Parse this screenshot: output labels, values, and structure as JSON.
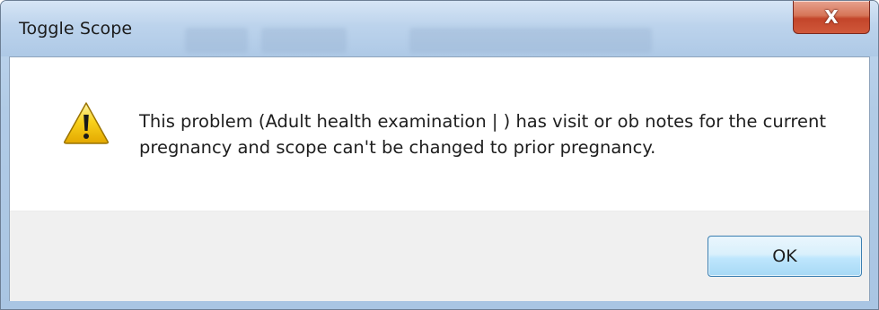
{
  "window": {
    "title": "Toggle Scope",
    "close_glyph": "X"
  },
  "message": {
    "icon": "warning-icon",
    "text": "This problem (Adult health examination | ) has visit or ob notes for the current pregnancy and scope can't be changed to prior pregnancy."
  },
  "buttons": {
    "ok_label": "OK"
  },
  "colors": {
    "titlebar": "#b9d1ea",
    "close_button": "#c7492e",
    "ok_button_border": "#3c7fb1",
    "warning_yellow": "#f5c400"
  }
}
